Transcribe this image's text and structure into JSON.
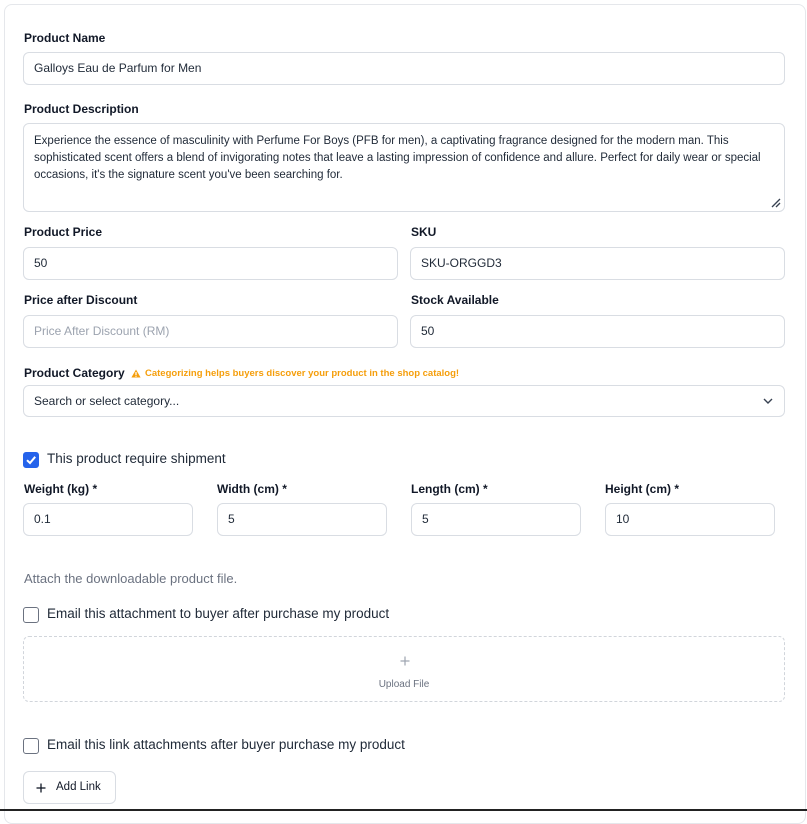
{
  "product_name": {
    "label": "Product Name",
    "value": "Galloys Eau de Parfum for Men"
  },
  "product_description": {
    "label": "Product Description",
    "value": "Experience the essence of masculinity with Perfume For Boys (PFB for men), a captivating fragrance designed for the modern man. This sophisticated scent offers a blend of invigorating notes that leave a lasting impression of confidence and allure. Perfect for daily wear or special occasions, it's the signature scent you've been searching for."
  },
  "product_price": {
    "label": "Product Price",
    "value": "50"
  },
  "sku": {
    "label": "SKU",
    "value": "SKU-ORGGD3"
  },
  "price_after_discount": {
    "label": "Price after Discount",
    "placeholder": "Price After Discount (RM)"
  },
  "stock_available": {
    "label": "Stock Available",
    "value": "50"
  },
  "product_category": {
    "label": "Product Category",
    "hint": "Categorizing helps buyers discover your product in the shop catalog!",
    "placeholder": "Search or select category..."
  },
  "shipment": {
    "checkbox_label": "This product require shipment",
    "checked": true,
    "weight": {
      "label": "Weight (kg) *",
      "value": "0.1"
    },
    "width": {
      "label": "Width (cm) *",
      "value": "5"
    },
    "length": {
      "label": "Length (cm) *",
      "value": "5"
    },
    "height": {
      "label": "Height (cm) *",
      "value": "10"
    }
  },
  "attachments": {
    "heading": "Attach the downloadable product file.",
    "email_attachment_label": "Email this attachment to buyer after purchase my product",
    "upload_label": "Upload File",
    "email_link_label": "Email this link attachments after buyer purchase my product",
    "add_link_label": "Add Link"
  },
  "colors": {
    "accent": "#2563eb",
    "warning": "#f59e0b",
    "border": "#d9dde3"
  }
}
